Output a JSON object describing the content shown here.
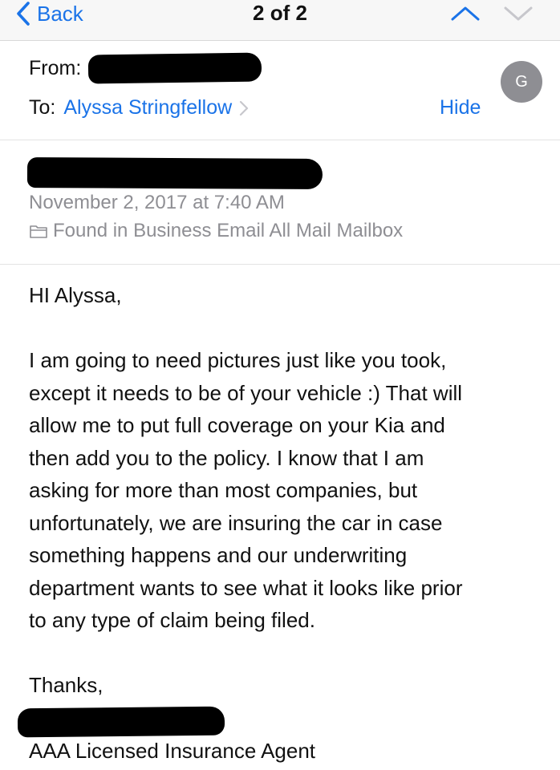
{
  "navbar": {
    "back_label": "Back",
    "counter": "2 of 2",
    "up_icon": "chevron-up-icon",
    "down_icon": "chevron-down-icon",
    "accent_color": "#1a73e8"
  },
  "header": {
    "from_label": "From:",
    "avatar_initial": "G",
    "to_label": "To:",
    "to_name": "Alyssa Stringfellow",
    "hide_label": "Hide"
  },
  "meta": {
    "date": "November 2, 2017 at 7:40 AM",
    "mailbox": "Found in Business Email All Mail Mailbox",
    "mailbox_icon": "folder-icon"
  },
  "message": {
    "greeting": "HI Alyssa,",
    "paragraph_lines": [
      "I am going to need pictures just like you took,",
      "except it needs to be of your vehicle :) That will",
      "allow me to put full coverage on your Kia and",
      "then add you to the policy. I know that I am",
      "asking for more than most companies, but",
      "unfortunately, we are insuring the car in case",
      "something happens and our underwriting",
      "department wants to see what it looks like prior",
      "to any type of claim being filed."
    ],
    "closing": "Thanks,",
    "signature_title": "AAA Licensed Insurance Agent"
  }
}
